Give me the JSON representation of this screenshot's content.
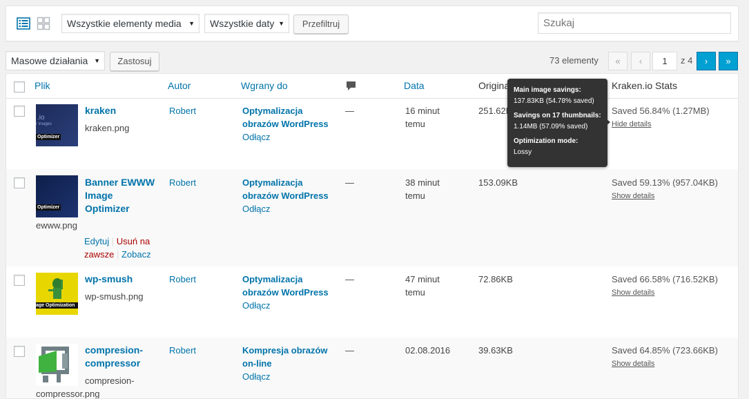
{
  "filter": {
    "media_type": "Wszystkie elementy media",
    "dates": "Wszystkie daty",
    "filter_button": "Przefiltruj",
    "search_placeholder": "Szukaj"
  },
  "tablenav": {
    "bulk_action": "Masowe działania",
    "apply_button": "Zastosuj",
    "count": "73 elementy",
    "first": "«",
    "prev": "‹",
    "page": "1",
    "of_pages": "z 4",
    "next": "›",
    "last": "»"
  },
  "columns": {
    "file": "Plik",
    "author": "Autor",
    "uploaded_to": "Wgrany do",
    "comments_icon": "comment-icon",
    "date": "Data",
    "original_size": "Original Size",
    "kraken_stats": "Kraken.io Stats"
  },
  "rows": [
    {
      "title": "kraken",
      "thumb_text": [
        ".io",
        "r images",
        "Optimizer"
      ],
      "filename": "kraken.png",
      "author": "Robert",
      "uploaded_to": [
        "Optymalizacja",
        "obrazów WordPress"
      ],
      "detach": "Odłącz",
      "comments": "—",
      "date": [
        "16 minut",
        "temu"
      ],
      "size": "251.62KB",
      "saved": "Saved 56.84% (1.27MB)",
      "details": "Hide details"
    },
    {
      "title": [
        "Banner EWWW",
        "Image",
        "Optimizer"
      ],
      "thumb_text": [
        "Optimizer"
      ],
      "filename": "ewww.png",
      "actions": {
        "edit": "Edytuj",
        "delete_1": "Usuń na",
        "delete_2": "zawsze",
        "view": "Zobacz"
      },
      "author": "Robert",
      "uploaded_to": [
        "Optymalizacja",
        "obrazów WordPress"
      ],
      "detach": "Odłącz",
      "comments": "—",
      "date": [
        "38 minut",
        "temu"
      ],
      "size": "153.09KB",
      "saved": "Saved 59.13% (957.04KB)",
      "details": "Show details"
    },
    {
      "title": "wp-smush",
      "thumb_text": [
        "age Optimization"
      ],
      "filename": "wp-smush.png",
      "author": "Robert",
      "uploaded_to": [
        "Optymalizacja",
        "obrazów WordPress"
      ],
      "detach": "Odłącz",
      "comments": "—",
      "date": [
        "47 minut",
        "temu"
      ],
      "size": "72.86KB",
      "saved": "Saved 66.58% (716.52KB)",
      "details": "Show details"
    },
    {
      "title": [
        "compresion-",
        "compressor"
      ],
      "filename": [
        "compresion-",
        "compressor.png"
      ],
      "author": "Robert",
      "uploaded_to": [
        "Kompresja obrazów",
        "on-line"
      ],
      "detach": "Odłącz",
      "comments": "—",
      "date": [
        "02.08.2016"
      ],
      "size": "39.63KB",
      "saved": "Saved 64.85% (723.66KB)",
      "details": "Show details"
    }
  ],
  "tooltip": {
    "main_label": "Main image savings:",
    "main_value": "137.83KB (54.78% saved)",
    "thumbs_label": "Savings on 17 thumbnails:",
    "thumbs_value": "1.14MB (57.09% saved)",
    "mode_label": "Optimization mode:",
    "mode_value": "Lossy"
  },
  "colors": {
    "link": "#0073aa",
    "delete": "#a00",
    "tooltip_bg": "#333333",
    "active_page": "#00a0d2"
  }
}
